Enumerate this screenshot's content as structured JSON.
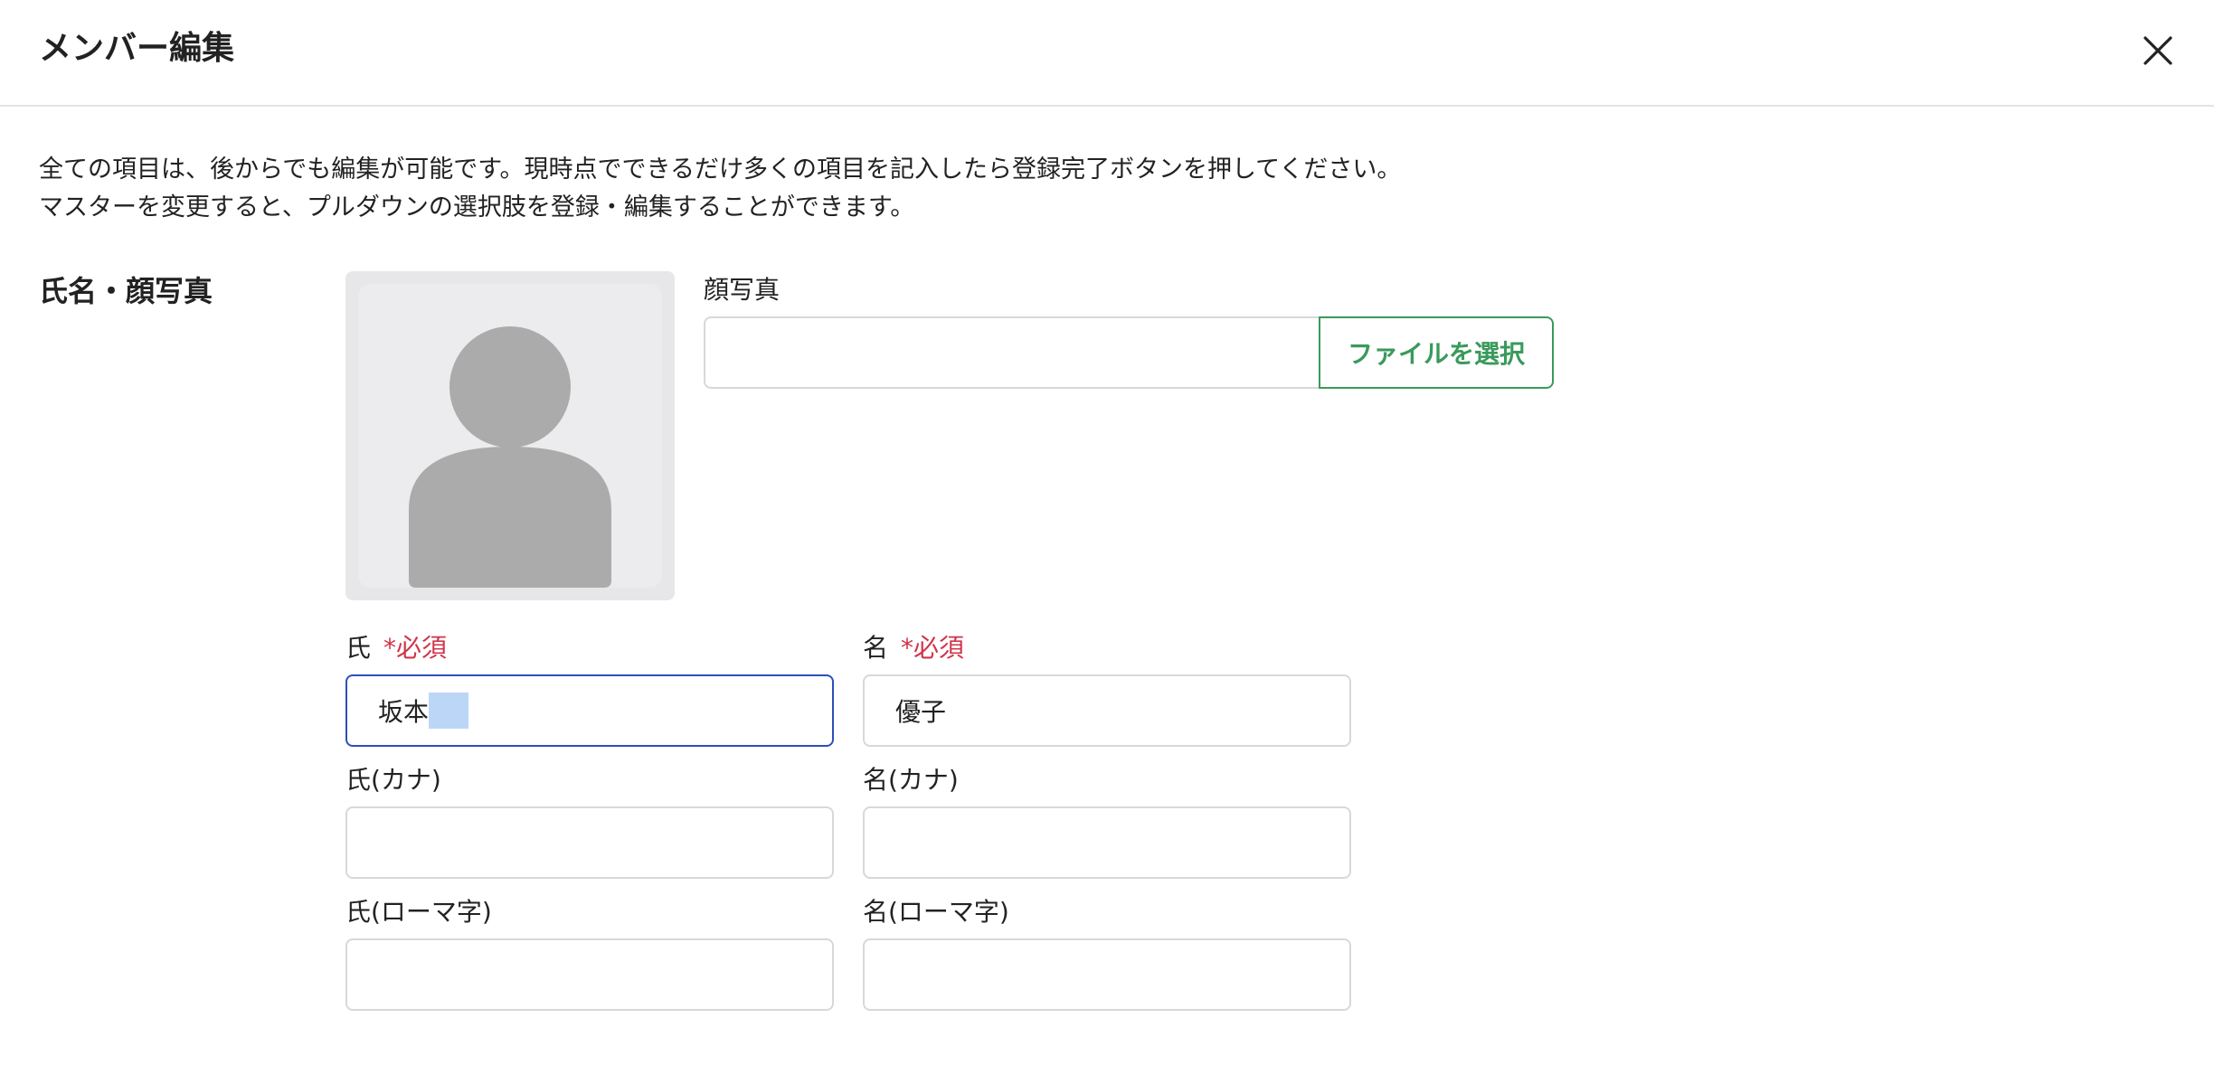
{
  "header": {
    "title": "メンバー編集"
  },
  "intro": {
    "line1": "全ての項目は、後からでも編集が可能です。現時点でできるだけ多くの項目を記入したら登録完了ボタンを押してください。",
    "line2": "マスターを変更すると、プルダウンの選択肢を登録・編集することができます。"
  },
  "section": {
    "label": "氏名・顔写真"
  },
  "photo": {
    "label": "顔写真",
    "file_value": "",
    "button_label": "ファイルを選択"
  },
  "fields": {
    "last_name": {
      "label": "氏",
      "required": "*必須",
      "value": "坂本"
    },
    "first_name": {
      "label": "名",
      "required": "*必須",
      "value": "優子"
    },
    "last_name_kana": {
      "label": "氏(カナ)",
      "value": ""
    },
    "first_name_kana": {
      "label": "名(カナ)",
      "value": ""
    },
    "last_name_roman": {
      "label": "氏(ローマ字)",
      "value": ""
    },
    "first_name_roman": {
      "label": "名(ローマ字)",
      "value": ""
    }
  },
  "colors": {
    "accent_green": "#3a9a5b",
    "required_red": "#d0344a",
    "focus_blue": "#2d4fb8",
    "selection": "#bcd6f7"
  },
  "icons": {
    "close": "close-icon",
    "avatar": "avatar-placeholder-icon"
  }
}
